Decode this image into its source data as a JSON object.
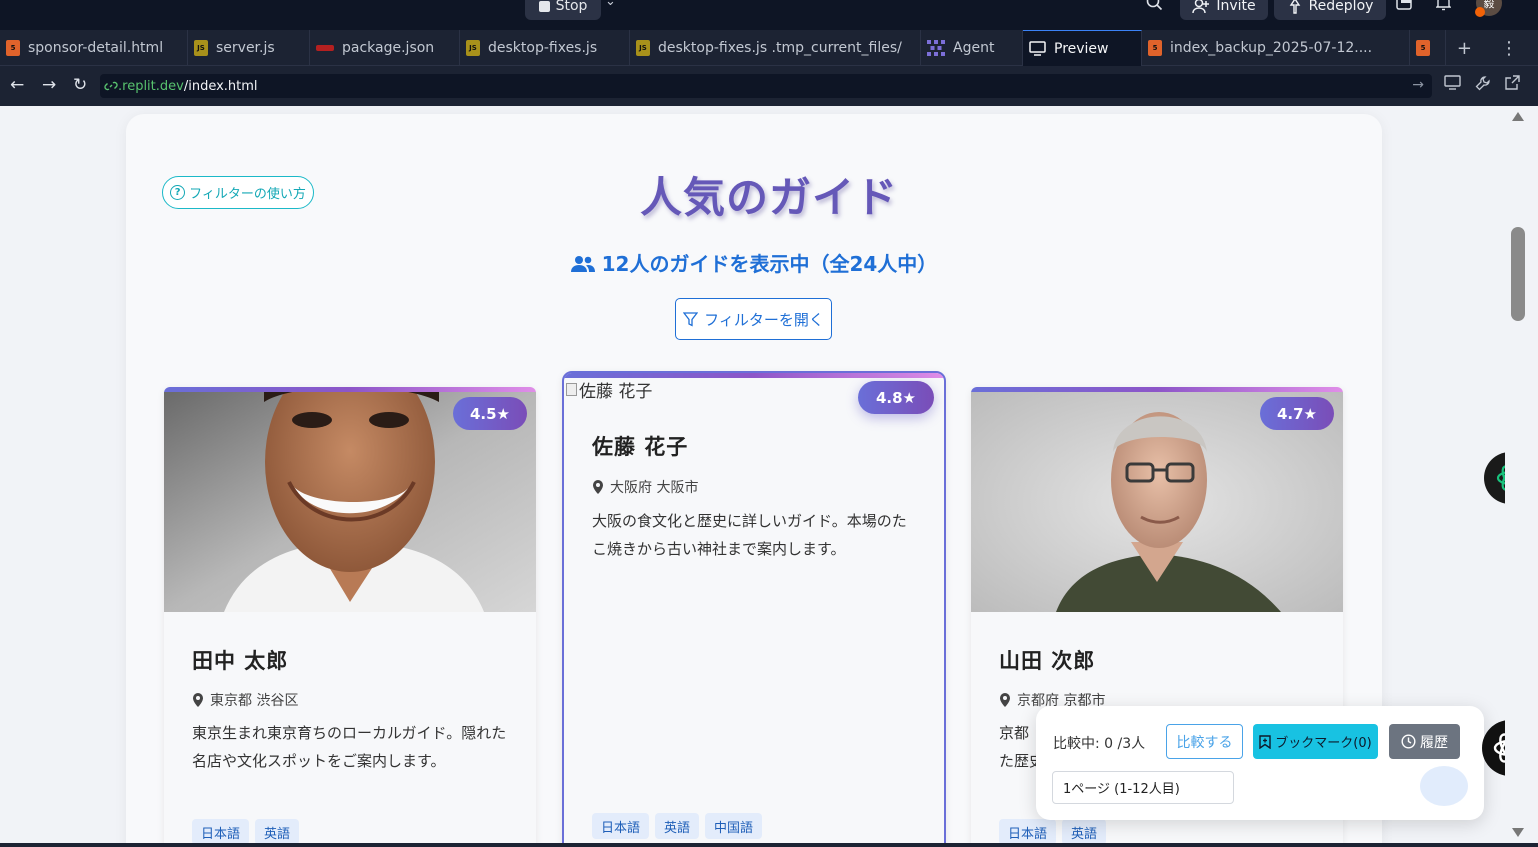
{
  "topbar": {
    "stop_label": "Stop",
    "invite_label": "Invite",
    "redeploy_label": "Redeploy",
    "avatar_initials": "毅"
  },
  "tabs": [
    {
      "label": "sponsor-detail.html",
      "icon": "html-file-icon"
    },
    {
      "label": "server.js",
      "icon": "js-file-icon"
    },
    {
      "label": "package.json",
      "icon": "npm-file-icon"
    },
    {
      "label": "desktop-fixes.js",
      "icon": "js-file-icon"
    },
    {
      "label": "desktop-fixes.js .tmp_current_files/",
      "icon": "js-file-icon"
    },
    {
      "label": "Agent",
      "icon": "agent-icon"
    },
    {
      "label": "Preview",
      "icon": "monitor-icon",
      "active": true
    },
    {
      "label": "index_backup_2025-07-12....",
      "icon": "html-file-icon"
    }
  ],
  "url": {
    "host": ".replit.dev",
    "path": "/index.html"
  },
  "page": {
    "help_button": "フィルターの使い方",
    "title": "人気のガイド",
    "count_text": "12人のガイドを表示中（全24人中）",
    "filter_button": "フィルターを開く"
  },
  "guides": [
    {
      "name": "田中 太郎",
      "rating": "4.5★",
      "location": "東京都 渋谷区",
      "description": "東京生まれ東京育ちのローカルガイド。隠れた名店や文化スポットをご案内します。",
      "languages": [
        "日本語",
        "英語"
      ]
    },
    {
      "name": "佐藤 花子",
      "rating": "4.8★",
      "image_alt": "佐藤 花子",
      "location": "大阪府 大阪市",
      "description": "大阪の食文化と歴史に詳しいガイド。本場のたこ焼きから古い神社まで案内します。",
      "languages": [
        "日本語",
        "英語",
        "中国語"
      ]
    },
    {
      "name": "山田 次郎",
      "rating": "4.7★",
      "location": "京都府 京都市",
      "description_visible": [
        "京都",
        "た歴史"
      ],
      "languages": [
        "日本語",
        "英語"
      ]
    }
  ],
  "compare": {
    "label": "比較中: 0 /3人",
    "compare_button": "比較する",
    "bookmark_button": "ブックマーク(0)",
    "history_button": "履歴",
    "page_select": "1ページ (1-12人目)"
  },
  "colors": {
    "title": "#6558b8",
    "link_blue": "#1f6fd6",
    "rating_gradient_start": "#6a6fd8",
    "rating_gradient_end": "#7a4db8",
    "bookmark": "#18c2e2"
  }
}
